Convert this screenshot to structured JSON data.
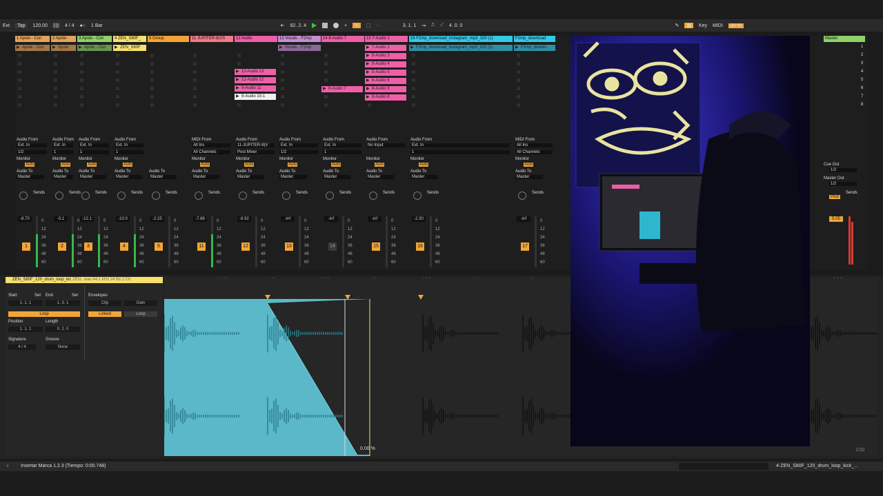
{
  "topbar": {
    "ext": "Ext",
    "tap": "Tap",
    "tempo": "120.00",
    "signature": "4 / 4",
    "quantize": "1 Bar",
    "position": "82.  2.  4",
    "loop_start": "3.  1.  1",
    "loop_len": "4.  0.  0",
    "key": "Key",
    "midi": "MIDI",
    "cpu": "30 %"
  },
  "tracks": [
    {
      "name": "1 Apste - Con",
      "color": "#e5a35a",
      "num": "1",
      "vol": "-8.70",
      "in_type": "Audio From",
      "in": "Ext. In",
      "ch": "1/2",
      "route": "Master",
      "clip": "Apste - Con"
    },
    {
      "name": "2 Apste -",
      "color": "#e5a35a",
      "num": "2",
      "vol": "-0.1",
      "in_type": "Audio From",
      "in": "Ext. In",
      "ch": "1",
      "route": "Master",
      "clip": "Apste"
    },
    {
      "name": "3 Apste - Con",
      "color": "#8fd06b",
      "num": "3",
      "vol": "-12.1",
      "in_type": "Audio From",
      "in": "Ext. In",
      "ch": "1",
      "route": "Master",
      "clip": "Apste - Con"
    },
    {
      "name": "4 ZEN_S80F_",
      "color": "#f7e06b",
      "num": "4",
      "vol": "-10.0",
      "in_type": "Audio From",
      "in": "Ext. In",
      "ch": "1",
      "route": "Master",
      "clip": "ZEN_S80F"
    },
    {
      "name": "5 Group",
      "color": "#f2a536",
      "num": "5",
      "vol": "-2.25",
      "in_type": "",
      "in": "",
      "ch": "",
      "route": "Master",
      "clip": ""
    },
    {
      "name": "11 JUPITER-8(VS",
      "color": "#f07a8a",
      "num": "11",
      "vol": "-7.88",
      "in_type": "MIDI From",
      "in": "All Ins",
      "ch": "All Channels",
      "route": "Master",
      "clip": ""
    },
    {
      "name": "12 Audio",
      "color": "#ee5fa8",
      "num": "12",
      "vol": "-8.92",
      "in_type": "Audio From",
      "in": "11-JUPITER-8(V",
      "ch": "Post Mixer",
      "route": "Master",
      "clip": "12-Audio 13"
    },
    {
      "name": "13 Vocals - F2mp",
      "color": "#c58ed3",
      "num": "13",
      "vol": "-inf",
      "in_type": "Audio From",
      "in": "Ext. In",
      "ch": "1/2",
      "route": "Master",
      "clip": "Vocals - F2mp"
    },
    {
      "name": "14 8-Audio 7",
      "color": "#ee5fa8",
      "num": "14",
      "vol": "-inf",
      "in_type": "Audio From",
      "in": "Ext. In",
      "ch": "1",
      "route": "Master",
      "clip": "8-Audio 7"
    },
    {
      "name": "15 7-Audio 1",
      "color": "#ee5fa8",
      "num": "15",
      "vol": "-inf",
      "in_type": "Audio From",
      "in": "No Input",
      "ch": "",
      "route": "Master",
      "clip": "7-Audio 1"
    },
    {
      "name": "16 F2mp_download_instagram_mp3_320 (1)",
      "color": "#35c7e6",
      "num": "16",
      "vol": "-2.30",
      "in_type": "Audio From",
      "in": "Ext. In",
      "ch": "1",
      "route": "Master",
      "clip": "F2mp_download_instagram_mp3_320 (1)"
    },
    {
      "name": "F2mp_download",
      "color": "#35c7e6",
      "num": "17",
      "vol": "-inf",
      "in_type": "MIDI From",
      "in": "All Ins",
      "ch": "All Channels",
      "route": "Master",
      "clip": "F2mp_downlo"
    }
  ],
  "clips_col7": [
    "12-Audio 13",
    "12-Audio 12",
    "9-Audio 11",
    "9-Audio 10-1"
  ],
  "clips_col9": [
    "7-Audio 1",
    "8-Audio 3",
    "8-Audio 4",
    "8-Audio 5",
    "8-Audio 6",
    "8-Audio 9",
    "8-Audio 8"
  ],
  "clips_col8": "8-Audio 7",
  "master": {
    "name": "Master",
    "scenes": [
      "1",
      "2",
      "3",
      "4",
      "5",
      "6",
      "7",
      "8"
    ],
    "cue_out": "Cue Out",
    "cue_val": "1/2",
    "master_out": "Master Out",
    "master_val": "1/2",
    "vol": "5.05",
    "sends": "Sends",
    "post": "Post"
  },
  "labels": {
    "monitor": "Monitor",
    "in": "In",
    "auto": "Auto",
    "off": "Off",
    "audio_to": "Audio To",
    "sends": "Sends",
    "a": "A",
    "b": "B"
  },
  "meter_scale": [
    "0",
    "12",
    "24",
    "36",
    "48",
    "60"
  ],
  "clipview": {
    "title": "ZEN_S80F_120_drum_loop_kic",
    "sub": "ZEN...wav  44.1 kHz 24 Bit 2 Ch",
    "start": "Start",
    "end": "End",
    "set": "Set",
    "start_val": "1.  1.  1",
    "end_val": "1.  3.  1",
    "envelopes": "Envelopes",
    "clip": "Clip",
    "gain": "Gain",
    "loop": "Loop",
    "linked": "Linked",
    "position": "Position",
    "length": "Length",
    "pos_val": "1.  1.  1",
    "len_val": "0.  2.  0",
    "signature": "Signature",
    "groove": "Groove",
    "sig_val": "4 / 4",
    "groove_val": "None",
    "ruler": [
      "1",
      "1.1.3",
      "1.2",
      "1.2.3",
      "1.3",
      "1.3.3",
      "1.4",
      "1.4.3",
      "2.3.3"
    ],
    "fade_pct": "0.00 %",
    "page": "1/32"
  },
  "status": {
    "message": "Insertar Marca 1.2.3 (Tiempo: 0:00.748)",
    "selected": "4-ZEN_S80F_120_drum_loop_kick_..."
  }
}
